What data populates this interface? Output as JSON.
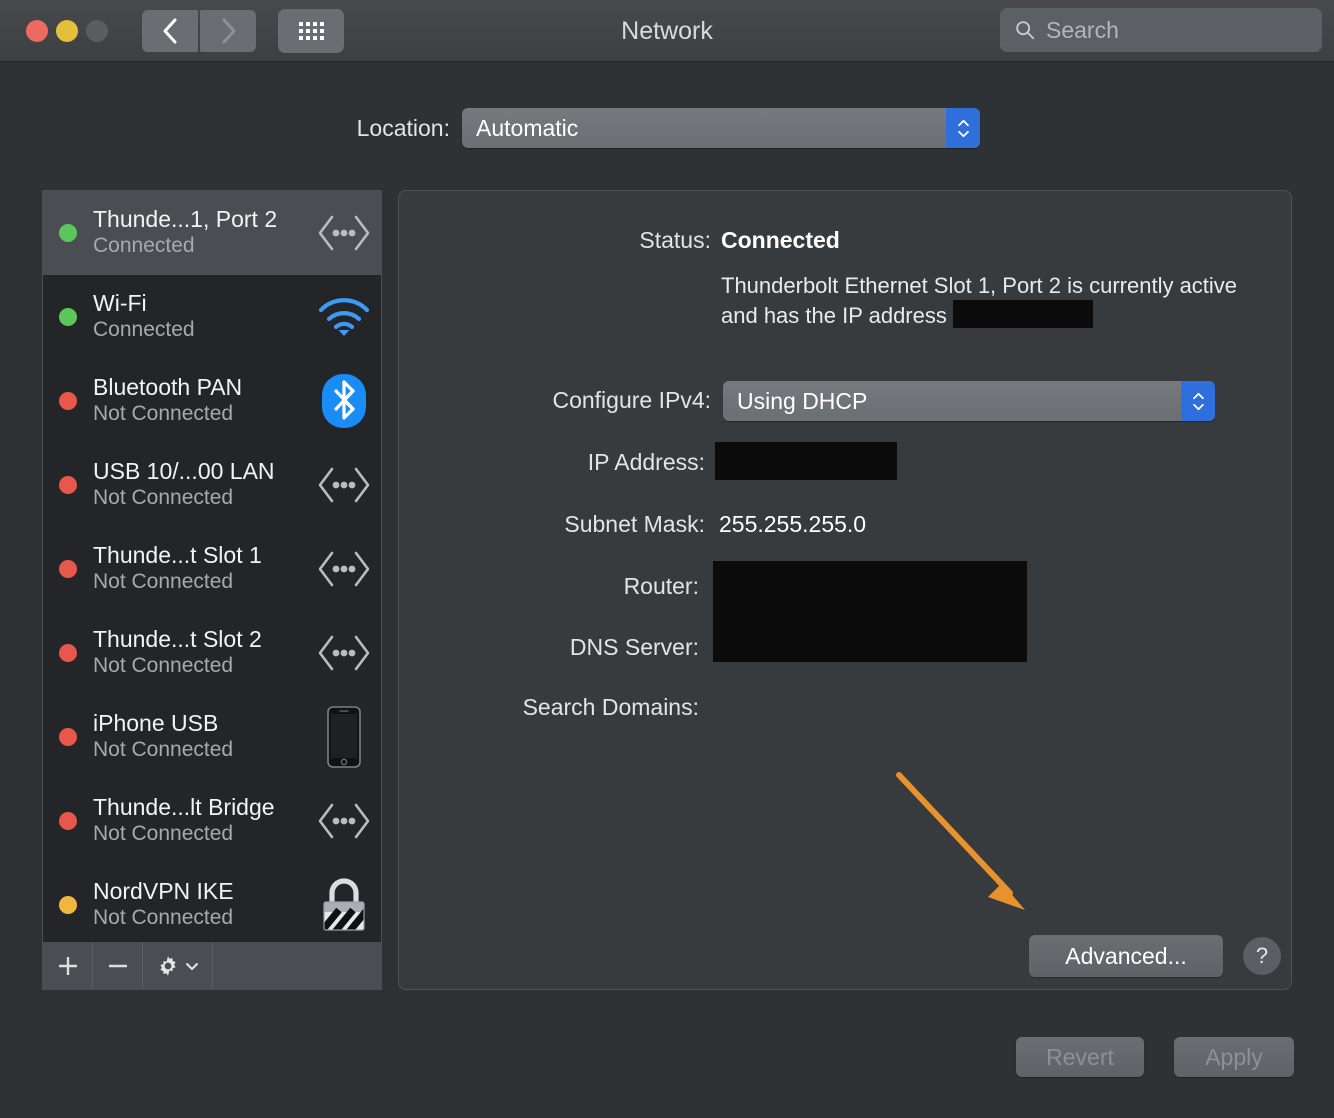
{
  "window": {
    "title": "Network",
    "traffic_lights": [
      "close",
      "minimize",
      "zoom"
    ],
    "nav": {
      "back": "back-icon",
      "forward": "forward-icon",
      "grid": "show-all-icon"
    }
  },
  "search": {
    "placeholder": "Search",
    "value": "",
    "icon": "search-icon"
  },
  "location": {
    "label": "Location:",
    "selected": "Automatic"
  },
  "services": [
    {
      "name": "Thunde...1, Port 2",
      "status": "Connected",
      "dot": "green",
      "icon": "ethernet-icon",
      "selected": true
    },
    {
      "name": "Wi-Fi",
      "status": "Connected",
      "dot": "green",
      "icon": "wifi-icon",
      "selected": false
    },
    {
      "name": "Bluetooth PAN",
      "status": "Not Connected",
      "dot": "red",
      "icon": "bluetooth-icon",
      "selected": false
    },
    {
      "name": "USB 10/...00 LAN",
      "status": "Not Connected",
      "dot": "red",
      "icon": "ethernet-icon",
      "selected": false
    },
    {
      "name": "Thunde...t Slot  1",
      "status": "Not Connected",
      "dot": "red",
      "icon": "ethernet-icon",
      "selected": false
    },
    {
      "name": "Thunde...t Slot  2",
      "status": "Not Connected",
      "dot": "red",
      "icon": "ethernet-icon",
      "selected": false
    },
    {
      "name": "iPhone USB",
      "status": "Not Connected",
      "dot": "red",
      "icon": "iphone-icon",
      "selected": false
    },
    {
      "name": "Thunde...lt Bridge",
      "status": "Not Connected",
      "dot": "red",
      "icon": "ethernet-icon",
      "selected": false
    },
    {
      "name": "NordVPN IKE",
      "status": "Not Connected",
      "dot": "yellow",
      "icon": "vpn-lock-icon",
      "selected": false
    }
  ],
  "list_toolbar": {
    "add": "+",
    "remove": "−",
    "gear": "gear-icon"
  },
  "detail": {
    "status_label": "Status:",
    "status_value": "Connected",
    "status_description_before": "Thunderbolt Ethernet Slot  1, Port 2 is currently active and has the IP address ",
    "status_description_redacted": true,
    "configure_label": "Configure IPv4:",
    "configure_value": "Using DHCP",
    "ip_label": "IP Address:",
    "ip_value": "",
    "ip_redacted": true,
    "subnet_label": "Subnet Mask:",
    "subnet_value": "255.255.255.0",
    "router_label": "Router:",
    "router_value": "",
    "router_redacted": true,
    "dns_label": "DNS Server:",
    "dns_value": "",
    "dns_redacted": true,
    "search_domains_label": "Search Domains:",
    "search_domains_value": "",
    "advanced_label": "Advanced...",
    "help_label": "?"
  },
  "annotation": {
    "type": "arrow",
    "color": "#e8912d",
    "points_to": "advanced-button"
  },
  "footer": {
    "revert_label": "Revert",
    "revert_enabled": false,
    "apply_label": "Apply",
    "apply_enabled": false
  },
  "colors": {
    "window_bg": "#2f3235",
    "titlebar": "#424548",
    "panel_bg": "#383b3e",
    "list_bg": "#232528",
    "selected_row": "#4a4d51",
    "accent_blue": "#2f6fdc",
    "status_green": "#5bc75a",
    "status_red": "#e8574b",
    "status_yellow": "#f0b73f",
    "annotation_orange": "#e8912d",
    "redaction": "#0b0b0c"
  }
}
